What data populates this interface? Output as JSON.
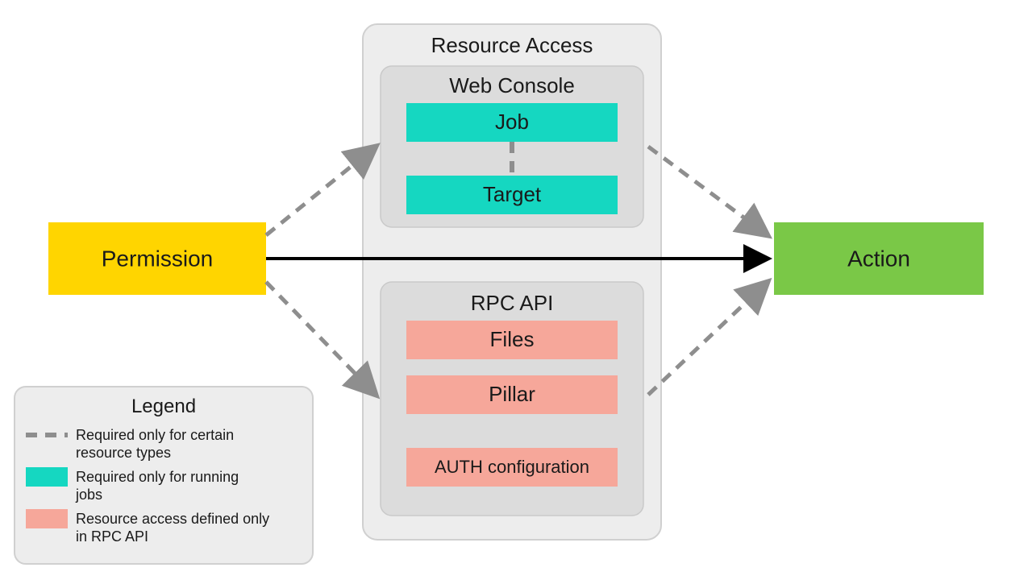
{
  "diagram": {
    "permission_label": "Permission",
    "action_label": "Action",
    "resource_access_title": "Resource Access",
    "web_console": {
      "title": "Web Console",
      "job": "Job",
      "target": "Target"
    },
    "rpc_api": {
      "title": "RPC API",
      "files": "Files",
      "pillar": "Pillar",
      "auth": "AUTH configuration"
    }
  },
  "legend": {
    "title": "Legend",
    "items": [
      {
        "type": "dash",
        "text1": "Required only for certain",
        "text2": "resource types"
      },
      {
        "type": "teal",
        "text1": "Required only for running",
        "text2": "jobs"
      },
      {
        "type": "salmon",
        "text1": "Resource access defined only",
        "text2": "in RPC API"
      }
    ]
  },
  "colors": {
    "yellow": "#ffd500",
    "green": "#7ac847",
    "teal": "#15d7c1",
    "salmon": "#f6a79a",
    "panel": "#ededed",
    "panel_inner": "#dcdcdc",
    "stroke_gray": "#8e8e8e",
    "stroke_panel": "#d0d0d0",
    "black": "#000000"
  }
}
